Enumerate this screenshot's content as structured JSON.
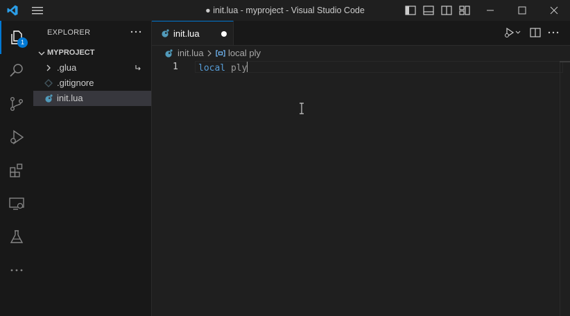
{
  "window": {
    "title": "● init.lua - myproject - Visual Studio Code"
  },
  "activity_bar": {
    "items": [
      {
        "name": "explorer",
        "active": true,
        "badge": "1"
      },
      {
        "name": "search"
      },
      {
        "name": "source-control"
      },
      {
        "name": "run-and-debug"
      },
      {
        "name": "extensions"
      },
      {
        "name": "remote-explorer"
      },
      {
        "name": "testing"
      },
      {
        "name": "more"
      }
    ]
  },
  "sidebar": {
    "header": "EXPLORER",
    "section": "MYPROJECT",
    "items": [
      {
        "label": ".glua",
        "type": "folder"
      },
      {
        "label": ".gitignore",
        "type": "file"
      },
      {
        "label": "init.lua",
        "type": "lua",
        "selected": true
      }
    ]
  },
  "tabs": [
    {
      "label": "init.lua",
      "dirty": true,
      "active": true
    }
  ],
  "breadcrumb": {
    "file": "init.lua",
    "symbol": "local ply"
  },
  "editor": {
    "lines": [
      {
        "number": "1",
        "keyword": "local",
        "identifier": "ply"
      }
    ]
  },
  "colors": {
    "accent": "#0078d4",
    "keyword": "#569cd6",
    "lua_icon": "#519aba"
  }
}
